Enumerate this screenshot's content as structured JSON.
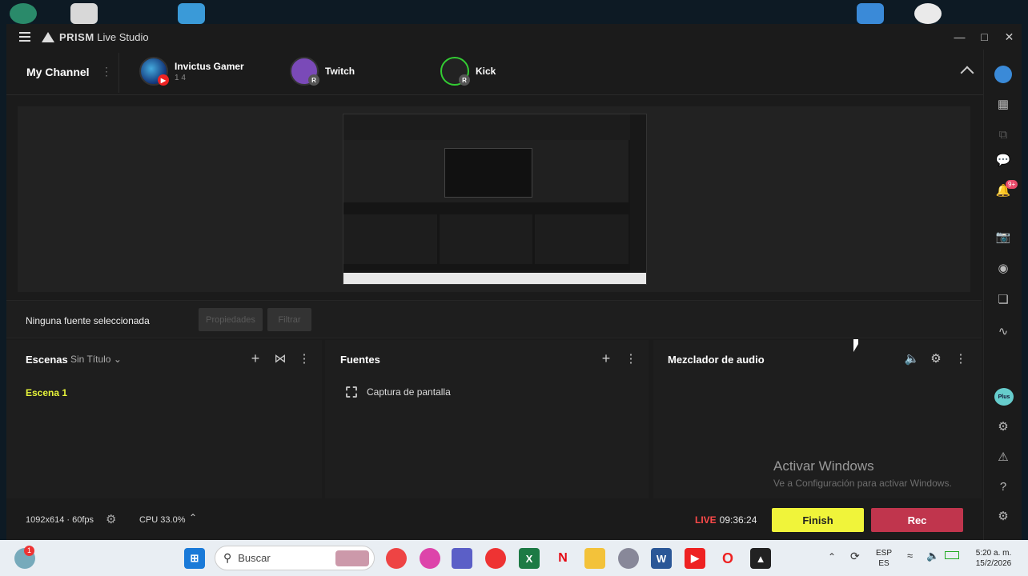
{
  "app": {
    "title_bold": "PRISM",
    "title_rest": "Live Studio"
  },
  "channels": {
    "my_channel": "My Channel",
    "items": [
      {
        "name": "Invictus Gamer",
        "stats": "1   4"
      },
      {
        "name": "Twitch",
        "stats": ""
      },
      {
        "name": "Kick",
        "stats": ""
      }
    ]
  },
  "source_bar": {
    "status": "Ninguna fuente seleccionada",
    "properties": "Propiedades",
    "filter": "Filtrar"
  },
  "scenes": {
    "title": "Escenas",
    "collection": "Sin Título",
    "items": [
      "Escena 1"
    ]
  },
  "sources": {
    "title": "Fuentes",
    "items": [
      "Captura de pantalla"
    ]
  },
  "audio": {
    "title": "Mezclador de audio"
  },
  "status": {
    "resolution": "1092x614 · 60fps",
    "cpu": "CPU 33.0%",
    "live_label": "LIVE",
    "live_time": "09:36:24",
    "finish": "Finish",
    "rec": "Rec"
  },
  "watermark": {
    "line1": "Activar Windows",
    "line2": "Ve a Configuración para activar Windows."
  },
  "rightbar": {
    "badge": "9+",
    "plus": "Plus"
  },
  "taskbar": {
    "search_placeholder": "Buscar",
    "lang_top": "ESP",
    "lang_bottom": "ES",
    "time": "5:20 a. m.",
    "date": "15/2/2026",
    "weather_badge": "1"
  },
  "colors": {
    "accent_yellow": "#f0f43a",
    "rec_red": "#c0354d",
    "live_red": "#ff4a4a",
    "scene_active": "#e6f43a"
  }
}
